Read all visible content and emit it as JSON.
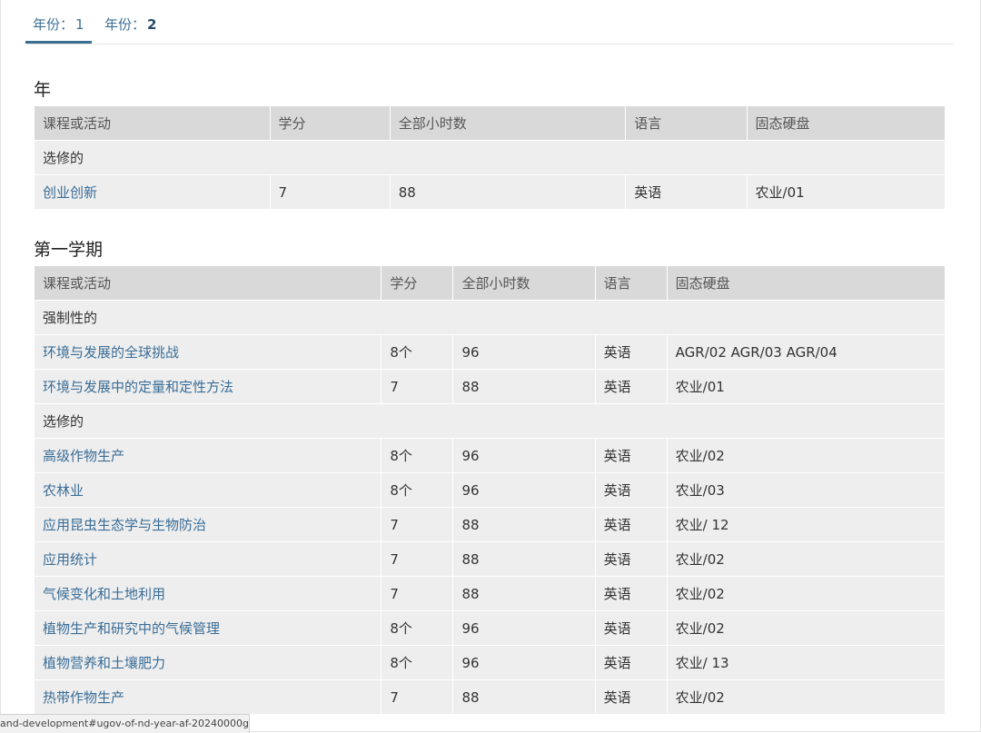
{
  "tabs": [
    {
      "label": "年份：",
      "value": "1"
    },
    {
      "label": "年份：",
      "value": "2"
    }
  ],
  "headers": {
    "course": "课程或活动",
    "credits": "学分",
    "hours": "全部小时数",
    "language": "语言",
    "ssd": "固态硬盘"
  },
  "section_year": {
    "title": "年",
    "groups": [
      {
        "label": "选修的",
        "rows": [
          {
            "course": "创业创新",
            "credits": "7",
            "hours": "88",
            "language": "英语",
            "ssd": "农业/01"
          }
        ]
      }
    ]
  },
  "section_sem1": {
    "title": "第一学期",
    "groups": [
      {
        "label": "强制性的",
        "rows": [
          {
            "course": "环境与发展的全球挑战",
            "credits": "8个",
            "hours": "96",
            "language": "英语",
            "ssd": "AGR/02 AGR/03 AGR/04"
          },
          {
            "course": "环境与发展中的定量和定性方法",
            "credits": "7",
            "hours": "88",
            "language": "英语",
            "ssd": "农业/01"
          }
        ]
      },
      {
        "label": "选修的",
        "rows": [
          {
            "course": "高级作物生产",
            "credits": "8个",
            "hours": "96",
            "language": "英语",
            "ssd": "农业/02"
          },
          {
            "course": "农林业",
            "credits": "8个",
            "hours": "96",
            "language": "英语",
            "ssd": "农业/03"
          },
          {
            "course": "应用昆虫生态学与生物防治",
            "credits": "7",
            "hours": "88",
            "language": "英语",
            "ssd": "农业/ 12"
          },
          {
            "course": "应用统计",
            "credits": "7",
            "hours": "88",
            "language": "英语",
            "ssd": "农业/02"
          },
          {
            "course": "气候变化和土地利用",
            "credits": "7",
            "hours": "88",
            "language": "英语",
            "ssd": "农业/02"
          },
          {
            "course": "植物生产和研究中的气候管理",
            "credits": "8个",
            "hours": "96",
            "language": "英语",
            "ssd": "农业/02"
          },
          {
            "course": "植物营养和土壤肥力",
            "credits": "8个",
            "hours": "96",
            "language": "英语",
            "ssd": "农业/ 13"
          },
          {
            "course": "热带作物生产",
            "credits": "7",
            "hours": "88",
            "language": "英语",
            "ssd": "农业/02"
          }
        ]
      }
    ]
  },
  "status_bar": {
    "url": "and-development#ugov-of-nd-year-af-20240000g..."
  },
  "colors": {
    "link": "#3a6d97",
    "header_bg": "#d9d9d9",
    "row_bg": "#eeeeee",
    "tab_active": "#3a6f93"
  }
}
